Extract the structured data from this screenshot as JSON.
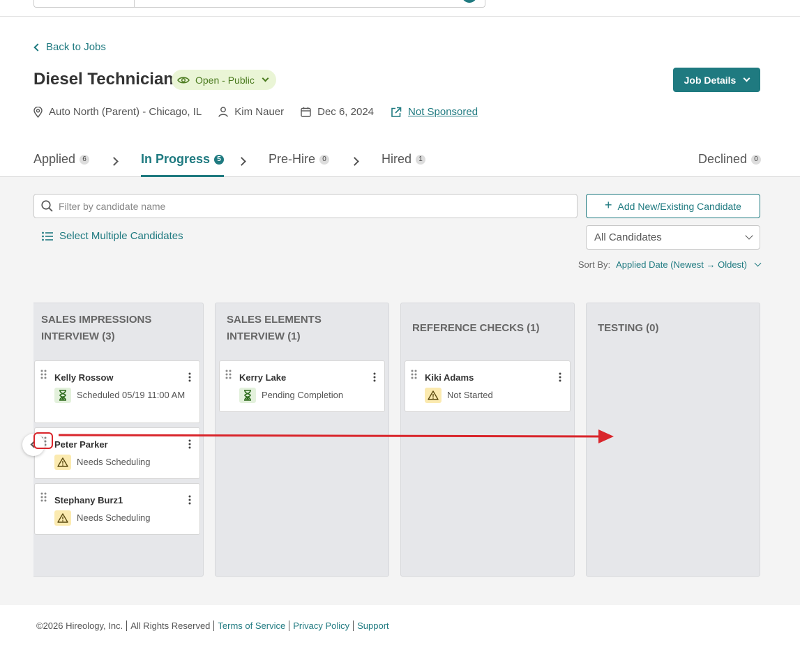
{
  "header": {
    "back_label": "Back to Jobs",
    "job_title": "Diesel Technician",
    "status": "Open - Public",
    "job_details_label": "Job Details",
    "meta": {
      "location": "Auto North (Parent) - Chicago, IL",
      "owner": "Kim Nauer",
      "date": "Dec 6, 2024",
      "sponsorship": "Not Sponsored"
    }
  },
  "tabs": [
    {
      "label": "Applied",
      "count": "6"
    },
    {
      "label": "In Progress",
      "count": "5"
    },
    {
      "label": "Pre-Hire",
      "count": "0"
    },
    {
      "label": "Hired",
      "count": "1"
    },
    {
      "label": "Declined",
      "count": "0"
    }
  ],
  "toolbar": {
    "search_placeholder": "Filter by candidate name",
    "add_label": "Add New/Existing Candidate",
    "select_multi_label": "Select Multiple Candidates",
    "filter_value": "All Candidates",
    "sort_label": "Sort By:",
    "sort_value": "Applied Date (Newest → Oldest)"
  },
  "columns": [
    {
      "title": "SALES IMPRESSIONS INTERVIEW (3)",
      "cards": [
        {
          "name": "Kelly Rossow",
          "status": "Scheduled 05/19 11:00 AM",
          "status_type": "hourglass"
        },
        {
          "name": "Peter Parker",
          "status": "Needs Scheduling",
          "status_type": "warning"
        },
        {
          "name": "Stephany Burz1",
          "status": "Needs Scheduling",
          "status_type": "warning"
        }
      ]
    },
    {
      "title": "SALES ELEMENTS INTERVIEW (1)",
      "cards": [
        {
          "name": "Kerry Lake",
          "status": "Pending Completion",
          "status_type": "hourglass"
        }
      ]
    },
    {
      "title": "REFERENCE CHECKS (1)",
      "cards": [
        {
          "name": "Kiki Adams",
          "status": "Not Started",
          "status_type": "warning"
        }
      ]
    },
    {
      "title": "TESTING (0)",
      "cards": []
    }
  ],
  "footer": {
    "copyright": "©2026 Hireology, Inc.",
    "rights": "All Rights Reserved",
    "terms": "Terms of Service",
    "privacy": "Privacy Policy",
    "support": "Support"
  },
  "colors": {
    "accent": "#1f7a80",
    "open_pill_bg": "#eaf5d6",
    "annotation_red": "#d9262c"
  }
}
